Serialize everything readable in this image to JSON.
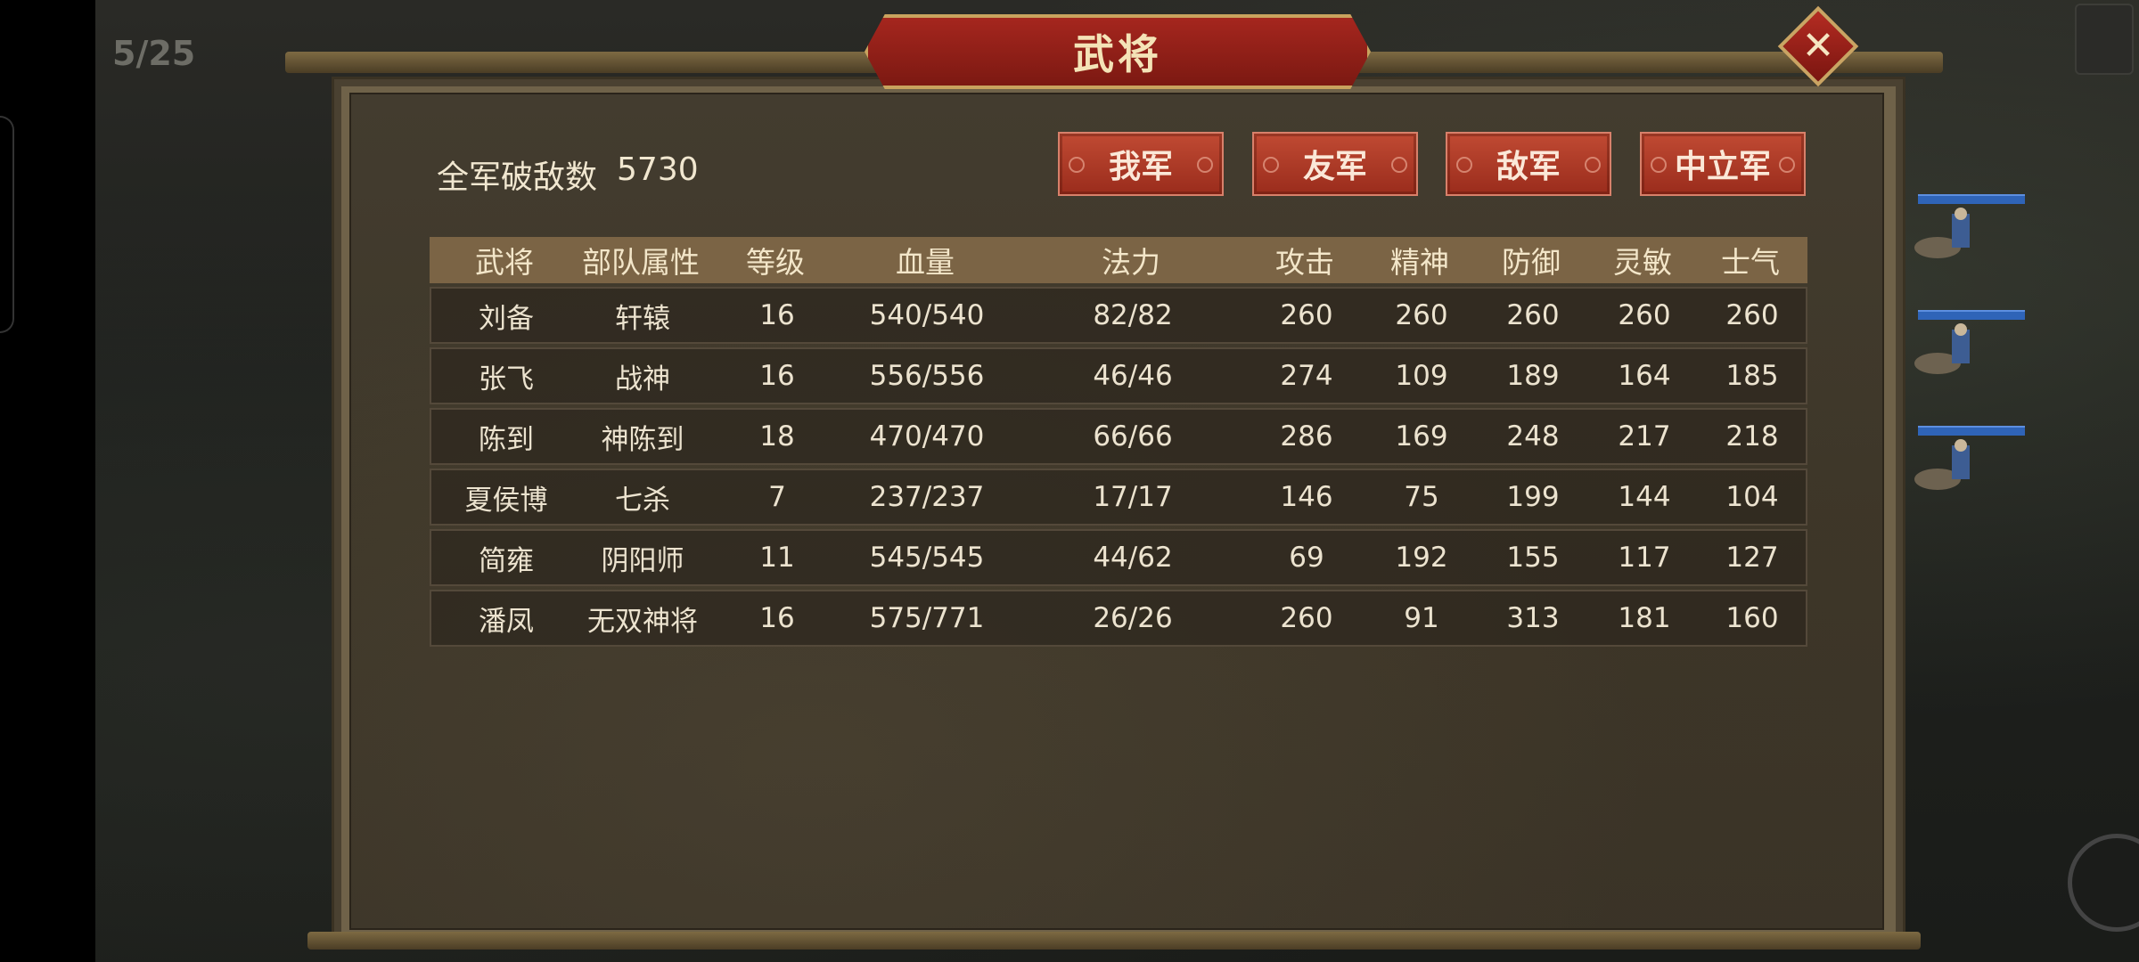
{
  "turn_counter": "5/25",
  "dialog": {
    "title": "武将",
    "close_icon": "close-icon",
    "kills_label": "全军破敌数",
    "kills_value": "5730",
    "filters": [
      "我军",
      "友军",
      "敌军",
      "中立军"
    ]
  },
  "table": {
    "headers": [
      "武将",
      "部队属性",
      "等级",
      "血量",
      "法力",
      "攻击",
      "精神",
      "防御",
      "灵敏",
      "士气"
    ],
    "rows": [
      [
        "刘备",
        "轩辕",
        "16",
        "540/540",
        "82/82",
        "260",
        "260",
        "260",
        "260",
        "260"
      ],
      [
        "张飞",
        "战神",
        "16",
        "556/556",
        "46/46",
        "274",
        "109",
        "189",
        "164",
        "185"
      ],
      [
        "陈到",
        "神陈到",
        "18",
        "470/470",
        "66/66",
        "286",
        "169",
        "248",
        "217",
        "218"
      ],
      [
        "夏侯博",
        "七杀",
        "7",
        "237/237",
        "17/17",
        "146",
        "75",
        "199",
        "144",
        "104"
      ],
      [
        "简雍",
        "阴阳师",
        "11",
        "545/545",
        "44/62",
        "69",
        "192",
        "155",
        "117",
        "127"
      ],
      [
        "潘凤",
        "无双神将",
        "16",
        "575/771",
        "26/26",
        "260",
        "91",
        "313",
        "181",
        "160"
      ]
    ]
  },
  "colors": {
    "title_banner": "#a5261e",
    "filter_button": "#c04a33",
    "table_header": "#7b6445",
    "panel": "#3e3729",
    "ally_bar": "#2f64b8"
  }
}
